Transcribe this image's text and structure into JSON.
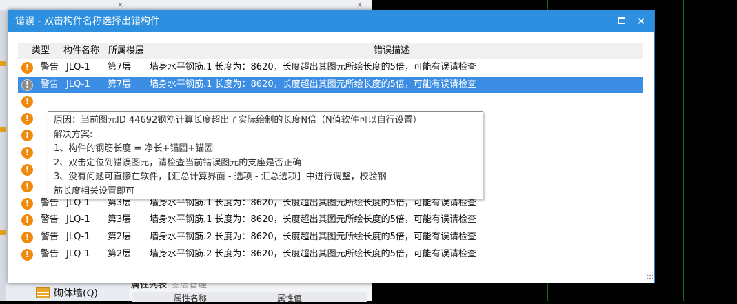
{
  "background": {
    "bottom_item_label": "砌体墙(Q)",
    "tabs": [
      "属性列表",
      "图层管理"
    ],
    "prop_columns": [
      "属性名称",
      "属性值"
    ],
    "close_glyph": "×"
  },
  "dialog": {
    "title": "错误 - 双击构件名称选择出错构件",
    "close_glyph": "✕",
    "columns": {
      "type": "类型",
      "name": "构件名称",
      "floor": "所属楼层",
      "desc": "错误描述"
    },
    "rows": [
      {
        "type": "警告",
        "name": "JLQ-1",
        "floor": "第7层",
        "desc": "墙身水平钢筋.1 长度为：8620，长度超出其图元所绘长度的5倍，可能有误请检查"
      },
      {
        "type": "警告",
        "name": "JLQ-1",
        "floor": "第7层",
        "desc": "墙身水平钢筋.1 长度为：8620，长度超出其图元所绘长度的5倍，可能有误请检查"
      },
      {
        "type": "",
        "name": "",
        "floor": "",
        "desc": ""
      },
      {
        "type": "",
        "name": "",
        "floor": "",
        "desc": ""
      },
      {
        "type": "",
        "name": "",
        "floor": "",
        "desc": ""
      },
      {
        "type": "",
        "name": "",
        "floor": "",
        "desc": ""
      },
      {
        "type": "",
        "name": "",
        "floor": "",
        "desc": ""
      },
      {
        "type": "",
        "name": "",
        "floor": "",
        "desc": ""
      },
      {
        "type": "警告",
        "name": "JLQ-1",
        "floor": "第3层",
        "desc": "墙身水平钢筋.1 长度为：8620，长度超出其图元所绘长度的5倍，可能有误请检查"
      },
      {
        "type": "警告",
        "name": "JLQ-1",
        "floor": "第3层",
        "desc": "墙身水平钢筋.1 长度为：8620，长度超出其图元所绘长度的5倍，可能有误请检查"
      },
      {
        "type": "警告",
        "name": "JLQ-1",
        "floor": "第2层",
        "desc": "墙身水平钢筋.2 长度为：8620，长度超出其图元所绘长度的5倍，可能有误请检查"
      },
      {
        "type": "警告",
        "name": "JLQ-1",
        "floor": "第2层",
        "desc": "墙身水平钢筋.2 长度为：8620，长度超出其图元所绘长度的5倍，可能有误请检查"
      }
    ],
    "tooltip": {
      "lines": [
        "原因：当前图元ID 44692钢筋计算长度超出了实际绘制的长度N倍（N值软件可以自行设置）",
        "解决方案:",
        "1、构件的钢筋长度 = 净长+锚固+锚固",
        "2、双击定位到错误图元，请检查当前错误图元的支座是否正确",
        "3、没有问题可直接在软件，【汇总计算界面 - 选项 - 汇总选项】中进行调整，校验钢",
        "筋长度相关设置即可"
      ]
    }
  },
  "colors": {
    "titlebar": "#2d8fe0",
    "selected_row": "#3b8ee3",
    "warning_icon": "#f08a0c"
  }
}
